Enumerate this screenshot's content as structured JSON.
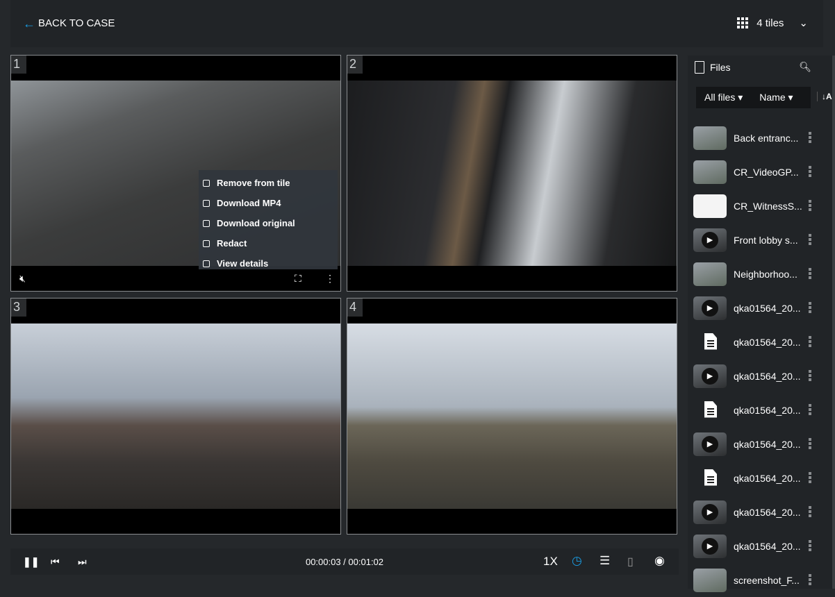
{
  "header": {
    "back_label": "BACK TO CASE",
    "tiles_label": "4 tiles"
  },
  "tiles": [
    {
      "number": "1",
      "video": "v1"
    },
    {
      "number": "2",
      "video": "v2"
    },
    {
      "number": "3",
      "video": "v3"
    },
    {
      "number": "4",
      "video": "v4"
    }
  ],
  "tile_menu": {
    "items": [
      "Remove from tile",
      "Download MP4",
      "Download original",
      "Redact",
      "View details"
    ]
  },
  "playback": {
    "time": "00:00:03 / 00:01:02",
    "speed": "1X",
    "accent": "#1a9be0"
  },
  "sidebar": {
    "title": "Files",
    "filter": "All files",
    "sort_by": "Name",
    "sort_icon": "↓AZ",
    "files": [
      {
        "name": "Back entranc...",
        "type": "img"
      },
      {
        "name": "CR_VideoGP...",
        "type": "img"
      },
      {
        "name": "CR_WitnessS...",
        "type": "wdoc"
      },
      {
        "name": "Front lobby s...",
        "type": "vid"
      },
      {
        "name": "Neighborhoo...",
        "type": "img"
      },
      {
        "name": "qka01564_20...",
        "type": "vid"
      },
      {
        "name": "qka01564_20...",
        "type": "doc"
      },
      {
        "name": "qka01564_20...",
        "type": "vid"
      },
      {
        "name": "qka01564_20...",
        "type": "doc"
      },
      {
        "name": "qka01564_20...",
        "type": "vid"
      },
      {
        "name": "qka01564_20...",
        "type": "doc"
      },
      {
        "name": "qka01564_20...",
        "type": "vid"
      },
      {
        "name": "qka01564_20...",
        "type": "vid"
      },
      {
        "name": "screenshot_F...",
        "type": "img"
      }
    ]
  }
}
